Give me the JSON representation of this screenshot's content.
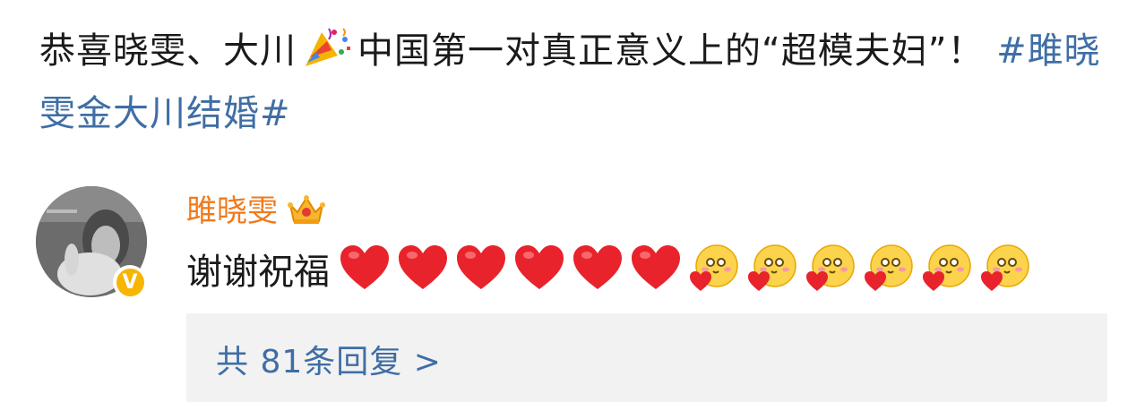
{
  "post": {
    "text_before_icon": "恭喜晓雯、大川",
    "icon": "party-popper-icon",
    "text_after_icon": "中国第一对真正意义上的“超模夫妇”！",
    "hashtag": "#雎晓雯金大川结婚#"
  },
  "comment": {
    "username": "雎晓雯",
    "badge_icon": "crown-icon",
    "verified_mark": "V",
    "text": "谢谢祝福",
    "hearts": [
      "red-heart-icon",
      "red-heart-icon",
      "red-heart-icon",
      "red-heart-icon",
      "red-heart-icon",
      "red-heart-icon"
    ],
    "love_faces": [
      "love-face-icon",
      "love-face-icon",
      "love-face-icon",
      "love-face-icon",
      "love-face-icon",
      "love-face-icon"
    ]
  },
  "replies": {
    "label": "共 81条回复 >"
  },
  "colors": {
    "hashtag": "#3f6ea5",
    "username": "#ef7a1d",
    "verified": "#f7b500",
    "reply_box": "#f2f2f2"
  }
}
